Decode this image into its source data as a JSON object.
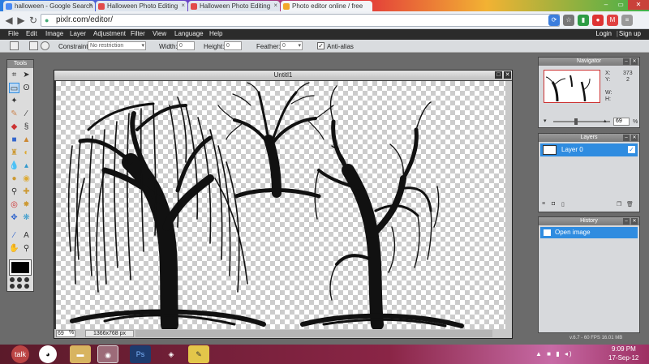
{
  "browser": {
    "tabs": [
      {
        "label": "halloween - Google Search",
        "color": "#4a8af4"
      },
      {
        "label": "Halloween Photo Editing",
        "color": "#e24a4a"
      },
      {
        "label": "Halloween Photo Editing",
        "color": "#e24a4a"
      },
      {
        "label": "Photo editor online / free",
        "color": "#f2a72a"
      }
    ],
    "url": "pixlr.com/editor/"
  },
  "menubar": {
    "items": [
      "File",
      "Edit",
      "Image",
      "Layer",
      "Adjustment",
      "Filter",
      "View",
      "Language",
      "Help"
    ],
    "login": "Login",
    "separator": "|",
    "signup": "Sign up"
  },
  "optionsbar": {
    "constraint_label": "Constraint:",
    "constraint_value": "No restriction",
    "width_label": "Width:",
    "width_value": "0",
    "height_label": "Height:",
    "height_value": "0",
    "feather_label": "Feather:",
    "feather_value": "0",
    "antialias_label": "Anti-alias"
  },
  "tools_panel": {
    "title": "Tools"
  },
  "document": {
    "title": "Untitl1",
    "zoom": "69",
    "zoom_unit": "%",
    "size": "1366x768 px"
  },
  "navigator": {
    "title": "Navigator",
    "x_label": "X:",
    "x_value": "373",
    "y_label": "Y:",
    "y_value": "2",
    "w_label": "W:",
    "h_label": "H:",
    "zoom": "69",
    "zoom_unit": "%"
  },
  "layers": {
    "title": "Layers",
    "items": [
      {
        "name": "Layer 0",
        "visible": true
      }
    ]
  },
  "history": {
    "title": "History",
    "items": [
      "Open image"
    ]
  },
  "status": {
    "fps": "v.6.7 - 60 FPS 16.01 MB"
  },
  "taskbar": {
    "talk_label": "talk",
    "tray_icons": "▲ ■ ▮ ◂)",
    "time": "9:09 PM",
    "date": "17-Sep-12"
  },
  "colors": {
    "accent": "#2f8ce0",
    "menubar_bg": "#2b2b2b",
    "workspace_bg": "#6b6b6b",
    "foreground_swatch": "#000000"
  }
}
